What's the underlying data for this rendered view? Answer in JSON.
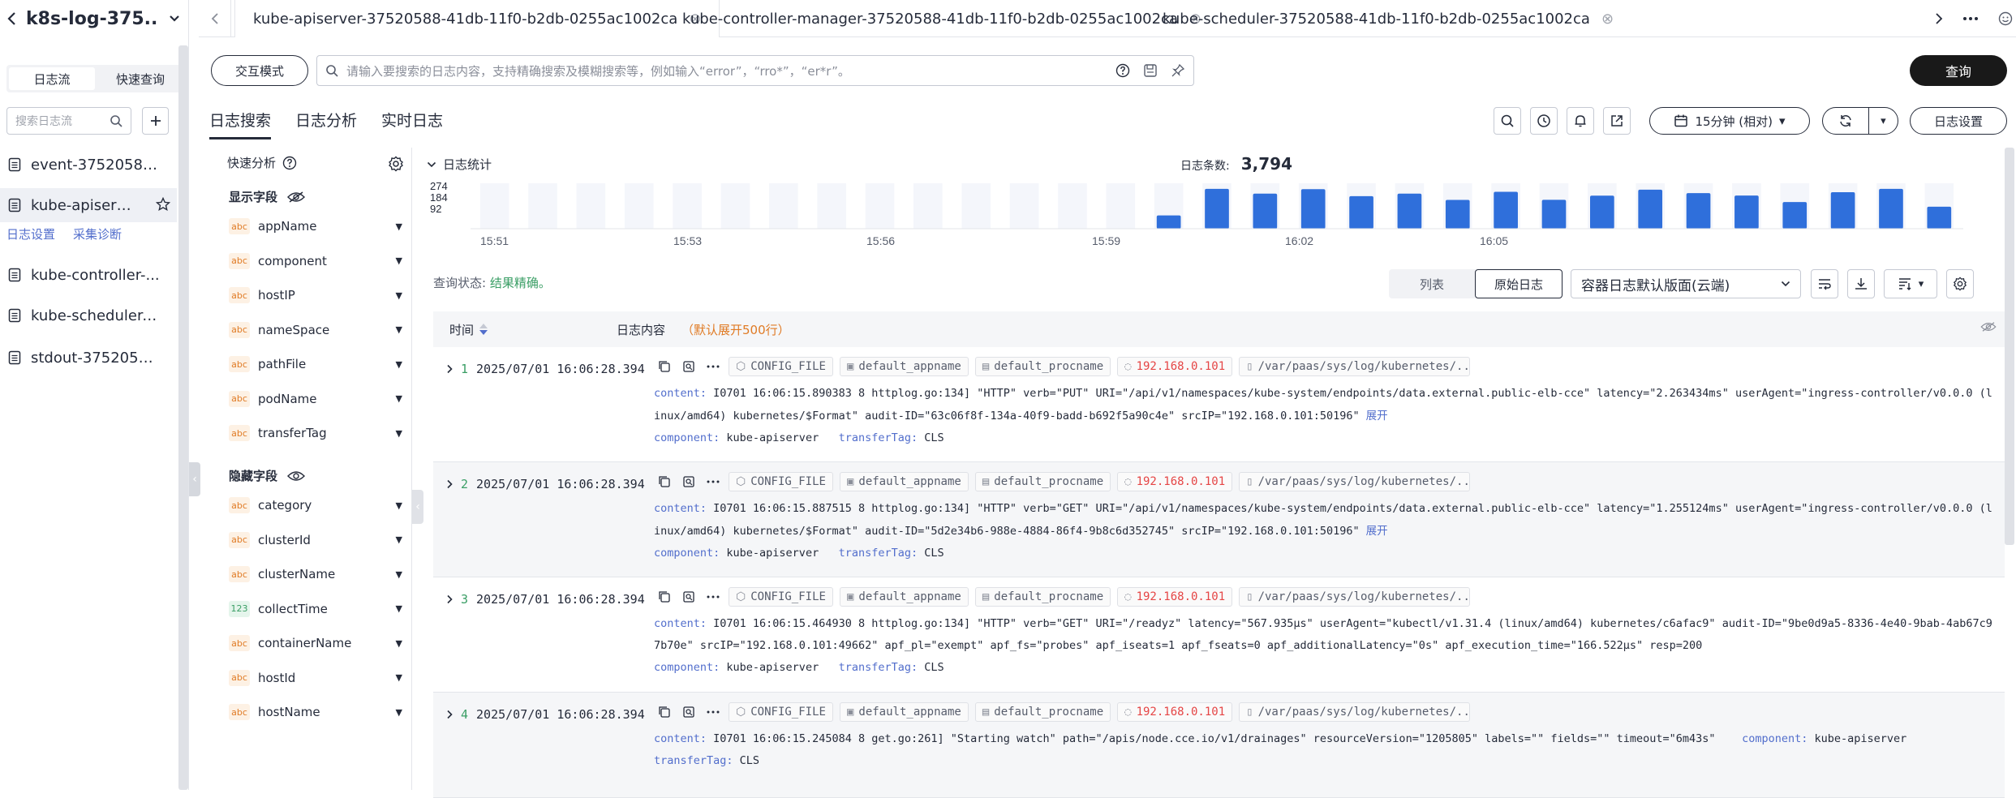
{
  "sidebar": {
    "title": "k8s-log-375..",
    "tabs": [
      "日志流",
      "快速查询"
    ],
    "search_placeholder": "搜索日志流",
    "streams": [
      {
        "name": "event-37520588-..."
      },
      {
        "name": "kube-apiserve..."
      },
      {
        "name": "kube-controller-..."
      },
      {
        "name": "kube-scheduler-..."
      },
      {
        "name": "stdout-37520588..."
      }
    ],
    "links": [
      "日志设置",
      "采集诊断"
    ]
  },
  "top_tabs": [
    {
      "label": "kube-apiserver-37520588-41db-11f0-b2db-0255ac1002ca"
    },
    {
      "label": "kube-controller-manager-37520588-41db-11f0-b2db-0255ac1002ca"
    },
    {
      "label": "kube-scheduler-37520588-41db-11f0-b2db-0255ac1002ca"
    }
  ],
  "query": {
    "mode_label": "交互模式",
    "placeholder": "请输入要搜索的日志内容，支持精确搜索及模糊搜索等，例如输入“error”，“rro*”，“er*r”。",
    "button_label": "查询"
  },
  "subtabs": [
    "日志搜索",
    "日志分析",
    "实时日志"
  ],
  "toolbar": {
    "time_range": "15分钟 (相对)",
    "log_settings": "日志设置"
  },
  "fields_panel": {
    "header": "快速分析",
    "shown_title": "显示字段",
    "shown": [
      {
        "type": "abc",
        "name": "appName"
      },
      {
        "type": "abc",
        "name": "component"
      },
      {
        "type": "abc",
        "name": "hostIP"
      },
      {
        "type": "abc",
        "name": "nameSpace"
      },
      {
        "type": "abc",
        "name": "pathFile"
      },
      {
        "type": "abc",
        "name": "podName"
      },
      {
        "type": "abc",
        "name": "transferTag"
      }
    ],
    "hidden_title": "隐藏字段",
    "hidden": [
      {
        "type": "abc",
        "name": "category"
      },
      {
        "type": "abc",
        "name": "clusterId"
      },
      {
        "type": "abc",
        "name": "clusterName"
      },
      {
        "type": "123",
        "name": "collectTime"
      },
      {
        "type": "abc",
        "name": "containerName"
      },
      {
        "type": "abc",
        "name": "hostId"
      },
      {
        "type": "abc",
        "name": "hostName"
      }
    ]
  },
  "histogram": {
    "title": "日志统计",
    "count_label": "日志条数:",
    "count_value": "3,794"
  },
  "chart_data": {
    "type": "bar",
    "y_ticks": [
      274,
      184,
      92
    ],
    "x_ticks": [
      "15:51",
      "15:53",
      "15:56",
      "15:59",
      "16:02",
      "16:05"
    ],
    "ylim": [
      0,
      300
    ],
    "values": [
      0,
      0,
      0,
      0,
      0,
      0,
      0,
      0,
      0,
      0,
      0,
      0,
      0,
      0,
      88,
      263,
      232,
      261,
      215,
      232,
      190,
      244,
      191,
      218,
      258,
      235,
      219,
      176,
      241,
      263,
      145
    ],
    "bar_color": "#2f6fdb"
  },
  "query_status": {
    "label": "查询状态:",
    "value": "结果精确。"
  },
  "view": {
    "options": [
      "列表",
      "原始日志"
    ],
    "active": "原始日志",
    "layout_select": "容器日志默认版面(云端)"
  },
  "log_table": {
    "col_time": "时间",
    "col_content": "日志内容",
    "content_hint": "（默认展开500行）",
    "expand_label": "展开",
    "rows": [
      {
        "index": "1",
        "time": "2025/07/01 16:06:28.394",
        "tags": [
          "CONFIG_FILE",
          "default_appname",
          "default_procname",
          "192.168.0.101",
          "/var/paas/sys/log/kubernetes/..."
        ],
        "content": "I0701 16:06:15.890383       8 httplog.go:134] \"HTTP\" verb=\"PUT\" URI=\"/api/v1/namespaces/kube-system/endpoints/data.external.public-elb-cce\" latency=\"2.263434ms\" userAgent=\"ingress-controller/v0.0.0 (linux/amd64) kubernetes/$Format\" audit-ID=\"63c06f8f-134a-40f9-badd-b692f5a90c4e\" srcIP=\"192.168.0.101:50196\"",
        "component": "kube-apiserver",
        "transferTag": "CLS",
        "expand": true
      },
      {
        "index": "2",
        "time": "2025/07/01 16:06:28.394",
        "tags": [
          "CONFIG_FILE",
          "default_appname",
          "default_procname",
          "192.168.0.101",
          "/var/paas/sys/log/kubernetes/..."
        ],
        "content": "I0701 16:06:15.887515       8 httplog.go:134] \"HTTP\" verb=\"GET\" URI=\"/api/v1/namespaces/kube-system/endpoints/data.external.public-elb-cce\" latency=\"1.255124ms\" userAgent=\"ingress-controller/v0.0.0 (linux/amd64) kubernetes/$Format\" audit-ID=\"5d2e34b6-988e-4884-86f4-9b8c6d352745\" srcIP=\"192.168.0.101:50196\"",
        "component": "kube-apiserver",
        "transferTag": "CLS",
        "expand": true
      },
      {
        "index": "3",
        "time": "2025/07/01 16:06:28.394",
        "tags": [
          "CONFIG_FILE",
          "default_appname",
          "default_procname",
          "192.168.0.101",
          "/var/paas/sys/log/kubernetes/..."
        ],
        "content": "I0701 16:06:15.464930       8 httplog.go:134] \"HTTP\" verb=\"GET\" URI=\"/readyz\" latency=\"567.935µs\" userAgent=\"kubectl/v1.31.4 (linux/amd64) kubernetes/c6afac9\" audit-ID=\"9be0d9a5-8336-4e40-9bab-4ab67c97b70e\" srcIP=\"192.168.0.101:49662\" apf_pl=\"exempt\" apf_fs=\"probes\" apf_iseats=1 apf_fseats=0 apf_additionalLatency=\"0s\" apf_execution_time=\"166.522µs\" resp=200",
        "component": "kube-apiserver",
        "transferTag": "CLS",
        "expand": false
      },
      {
        "index": "4",
        "time": "2025/07/01 16:06:28.394",
        "tags": [
          "CONFIG_FILE",
          "default_appname",
          "default_procname",
          "192.168.0.101",
          "/var/paas/sys/log/kubernetes/..."
        ],
        "content": "I0701 16:06:15.245084       8 get.go:261] \"Starting watch\" path=\"/apis/node.cce.io/v1/drainages\" resourceVersion=\"1205805\" labels=\"\" fields=\"\" timeout=\"6m43s\"",
        "component": "kube-apiserver",
        "transferTag": "CLS",
        "expand": false
      }
    ]
  }
}
